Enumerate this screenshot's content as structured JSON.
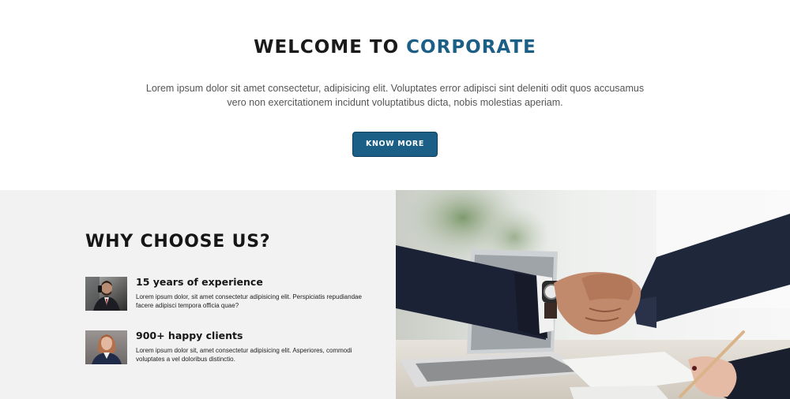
{
  "welcome": {
    "title_prefix": "WELCOME TO ",
    "title_accent": "CORPORATE",
    "text": "Lorem ipsum dolor sit amet consectetur, adipisicing elit. Voluptates error adipisci sint deleniti odit quos accusamus vero non exercitationem incidunt voluptatibus dicta, nobis molestias aperiam.",
    "button_label": "KNOW MORE"
  },
  "why": {
    "title": "WHY CHOOSE US?",
    "features": [
      {
        "heading": "15 years of experience",
        "text": "Lorem ipsum dolor, sit amet consectetur adipisicing elit. Perspiciatis repudiandae facere adipisci tempora officia quae?",
        "image": "man-on-phone-photo"
      },
      {
        "heading": "900+ happy clients",
        "text": "Lorem ipsum dolor sit, amet consectetur adipisicing elit. Asperiores, commodi voluptates a vel doloribus distinctio.",
        "image": "woman-portrait-photo"
      }
    ]
  },
  "photo": {
    "image": "handshake-photo"
  },
  "colors": {
    "accent": "#1b5e86",
    "section_bg": "#f1f2f1",
    "heading": "#161616",
    "body_text": "#555555"
  }
}
